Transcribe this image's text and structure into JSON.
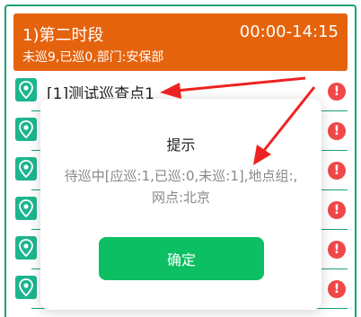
{
  "header": {
    "title": "1)第二时段",
    "time_range": "00:00-14:15",
    "summary": "未巡9,已巡0,部门:安保部"
  },
  "checkpoints": [
    {
      "label": "[1]测试巡查点1",
      "status": "!"
    },
    {
      "label": "",
      "status": "!"
    },
    {
      "label": "",
      "status": "!"
    },
    {
      "label": "",
      "status": "!"
    },
    {
      "label": "",
      "status": "!"
    },
    {
      "label": "",
      "status": "!"
    }
  ],
  "dialog": {
    "title": "提示",
    "message": "待巡中[应巡:1,已巡:0,未巡:1],地点组:,网点:北京",
    "confirm_label": "确定"
  },
  "colors": {
    "header_bg": "#e5630d",
    "accent_green": "#1aa179",
    "confirm_button": "#0bbf62",
    "warning_icon": "#f04848",
    "arrow": "#ee2222"
  }
}
